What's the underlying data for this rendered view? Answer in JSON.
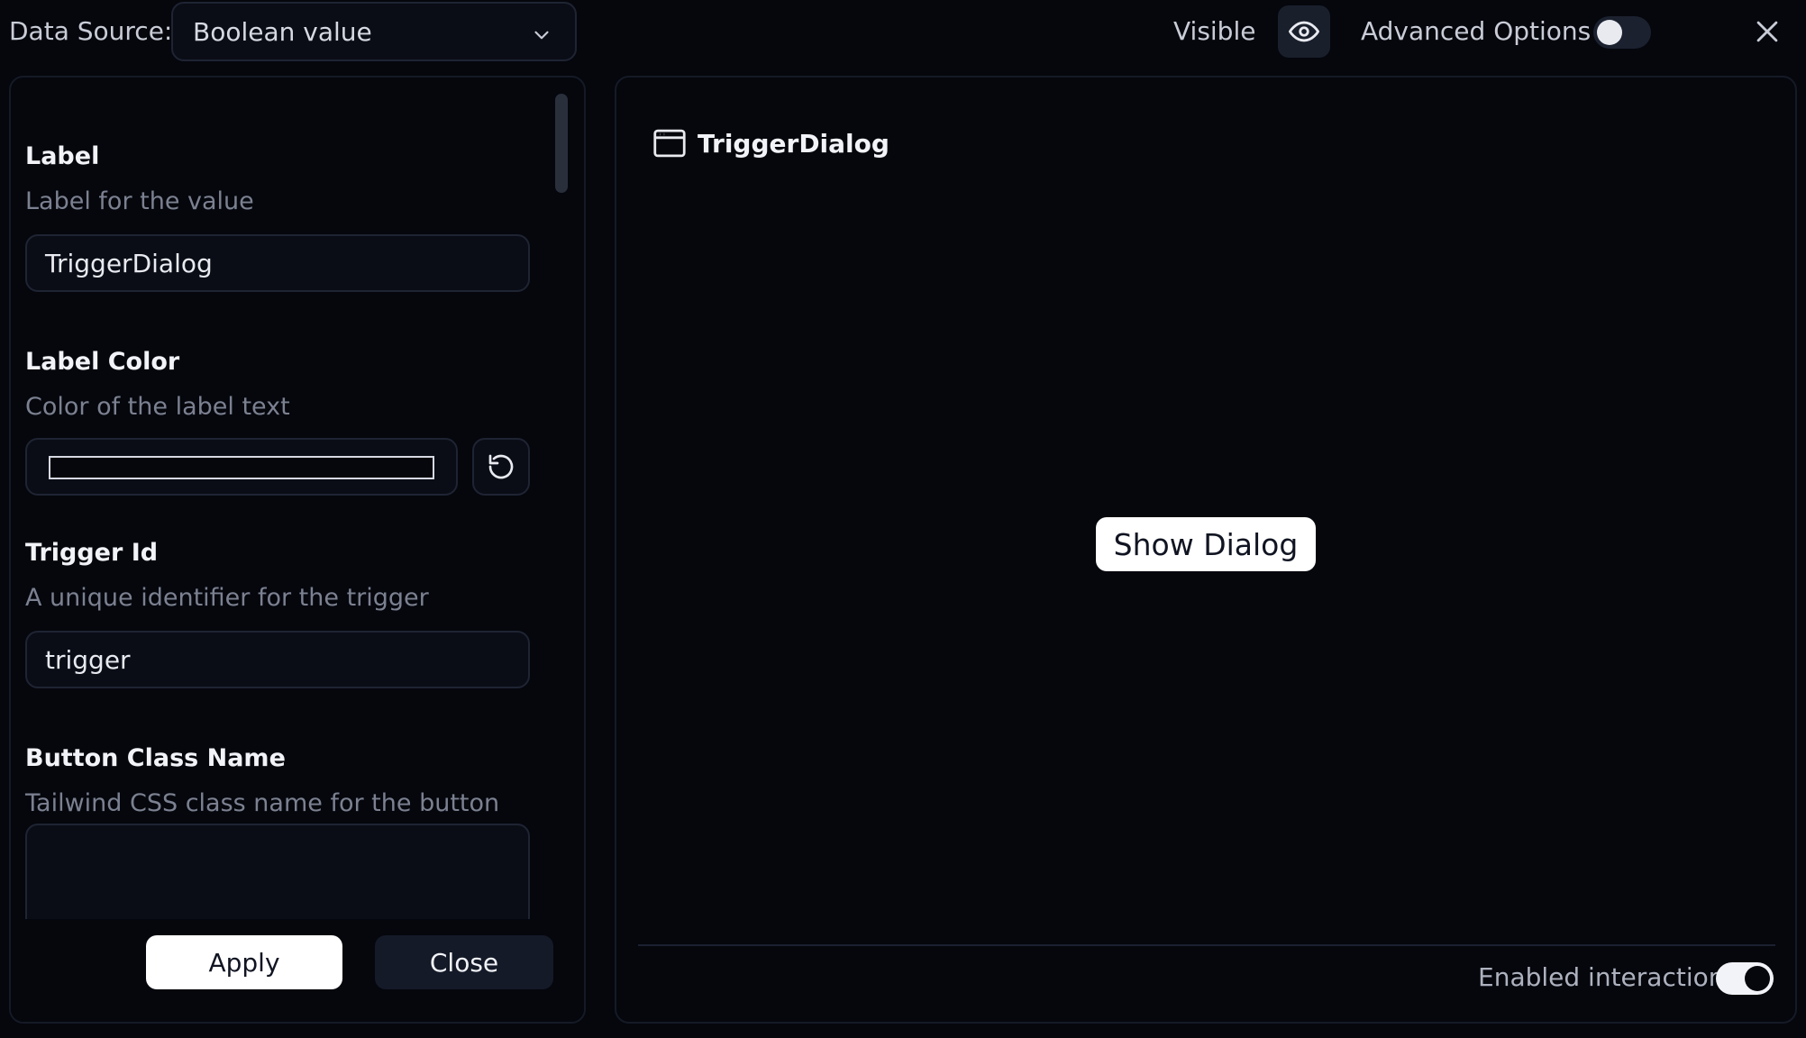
{
  "topbar": {
    "data_source_label": "Data Source:",
    "data_source_value": "Boolean value",
    "visible_label": "Visible",
    "advanced_options_label": "Advanced Options",
    "advanced_options_enabled": false
  },
  "form": {
    "label": {
      "title": "Label",
      "description": "Label for the value",
      "value": "TriggerDialog"
    },
    "label_color": {
      "title": "Label Color",
      "description": "Color of the label text"
    },
    "trigger_id": {
      "title": "Trigger Id",
      "description": "A unique identifier for the trigger",
      "value": "trigger"
    },
    "button_class_name": {
      "title": "Button Class Name",
      "description": "Tailwind CSS class name for the button",
      "value": ""
    },
    "apply_label": "Apply",
    "close_label": "Close"
  },
  "preview": {
    "title": "TriggerDialog",
    "button_label": "Show Dialog",
    "enabled_interactions_label": "Enabled interactions",
    "enabled_interactions": true
  },
  "icons": {
    "chevron": "chevron-down-icon",
    "eye": "eye-icon",
    "close": "close-icon",
    "reset": "reset-icon",
    "window": "window-icon"
  }
}
